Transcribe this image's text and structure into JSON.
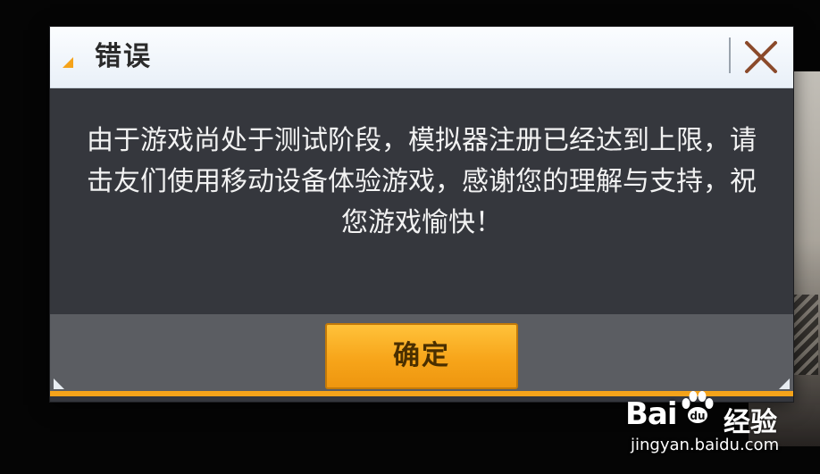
{
  "dialog": {
    "title": "错误",
    "message": "由于游戏尚处于测试阶段，模拟器注册已经达到上限，请击友们使用移动设备体验游戏，感谢您的理解与支持，祝您游戏愉快！",
    "confirm_label": "确定",
    "close_icon": "close-icon"
  },
  "watermark": {
    "brand_left": "Bai",
    "brand_right": "经验",
    "url": "jingyan.baidu.com"
  },
  "colors": {
    "accent": "#f5a31a",
    "dialog_body": "#35373d",
    "header": "#f3f7fb",
    "close_icon": "#8b4a2b"
  }
}
